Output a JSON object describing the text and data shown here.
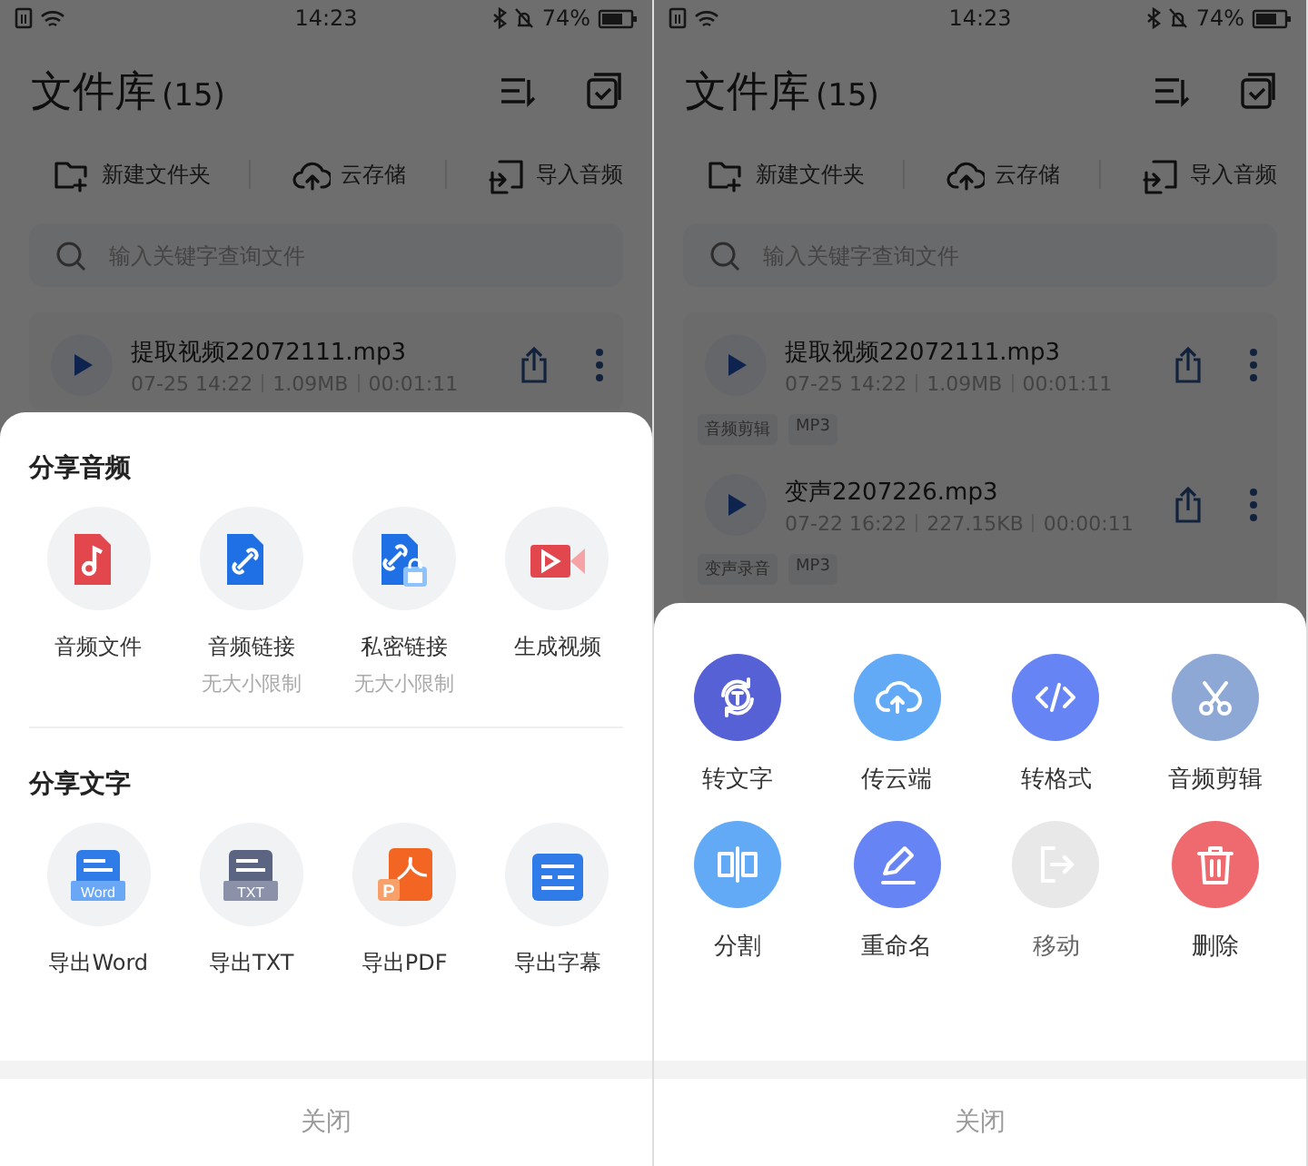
{
  "screens": [
    {
      "status_bar": {
        "time": "14:23",
        "battery": "74%"
      },
      "header": {
        "title": "文件库",
        "count": "(15)"
      },
      "toolbar": [
        {
          "kind": "folder",
          "label": "新建文件夹"
        },
        {
          "kind": "cloud",
          "label": "云存储"
        },
        {
          "kind": "import",
          "label": "导入音频"
        }
      ],
      "search": {
        "placeholder": "输入关键字查询文件"
      },
      "files": [
        {
          "name": "提取视频22072111.mp3",
          "date": "07-25 14:22",
          "size": "1.09MB",
          "duration": "00:01:11"
        }
      ],
      "sheet": {
        "kind": "share",
        "sections": [
          {
            "title": "分享音频",
            "items": [
              {
                "kind": "audio",
                "label": "音频文件"
              },
              {
                "kind": "link",
                "label": "音频链接",
                "note": "无大小限制"
              },
              {
                "kind": "private",
                "label": "私密链接",
                "note": "无大小限制"
              },
              {
                "kind": "video",
                "label": "生成视频"
              }
            ]
          },
          {
            "title": "分享文字",
            "items": [
              {
                "kind": "word",
                "label": "导出Word",
                "badge": "Word"
              },
              {
                "kind": "txt",
                "label": "导出TXT",
                "badge": "TXT"
              },
              {
                "kind": "pdf",
                "label": "导出PDF",
                "badge": "P"
              },
              {
                "kind": "subtitle",
                "label": "导出字幕"
              }
            ]
          }
        ],
        "close": "关闭"
      }
    },
    {
      "status_bar": {
        "time": "14:23",
        "battery": "74%"
      },
      "header": {
        "title": "文件库",
        "count": "(15)"
      },
      "toolbar": [
        {
          "kind": "folder",
          "label": "新建文件夹"
        },
        {
          "kind": "cloud",
          "label": "云存储"
        },
        {
          "kind": "import",
          "label": "导入音频"
        }
      ],
      "search": {
        "placeholder": "输入关键字查询文件"
      },
      "files": [
        {
          "name": "提取视频22072111.mp3",
          "date": "07-25 14:22",
          "size": "1.09MB",
          "duration": "00:01:11",
          "tags": [
            "音频剪辑",
            "MP3"
          ]
        },
        {
          "name": "变声2207226.mp3",
          "date": "07-22 16:22",
          "size": "227.15KB",
          "duration": "00:00:11",
          "tags": [
            "变声录音",
            "MP3"
          ]
        }
      ],
      "sheet": {
        "kind": "actions",
        "items": [
          {
            "kind": "transcribe",
            "label": "转文字",
            "color": "#5561d4",
            "disabled": false
          },
          {
            "kind": "upload",
            "label": "传云端",
            "color": "#62aaf6",
            "disabled": false
          },
          {
            "kind": "convert",
            "label": "转格式",
            "color": "#6684f4",
            "disabled": false
          },
          {
            "kind": "trim",
            "label": "音频剪辑",
            "color": "#8ea8d6",
            "disabled": false
          },
          {
            "kind": "split",
            "label": "分割",
            "color": "#62aaf6",
            "disabled": false
          },
          {
            "kind": "rename",
            "label": "重命名",
            "color": "#6684f4",
            "disabled": false
          },
          {
            "kind": "move",
            "label": "移动",
            "color": "#dddddd",
            "disabled": true
          },
          {
            "kind": "delete",
            "label": "删除",
            "color": "#ee6a6e",
            "disabled": false
          }
        ],
        "close": "关闭"
      }
    }
  ]
}
